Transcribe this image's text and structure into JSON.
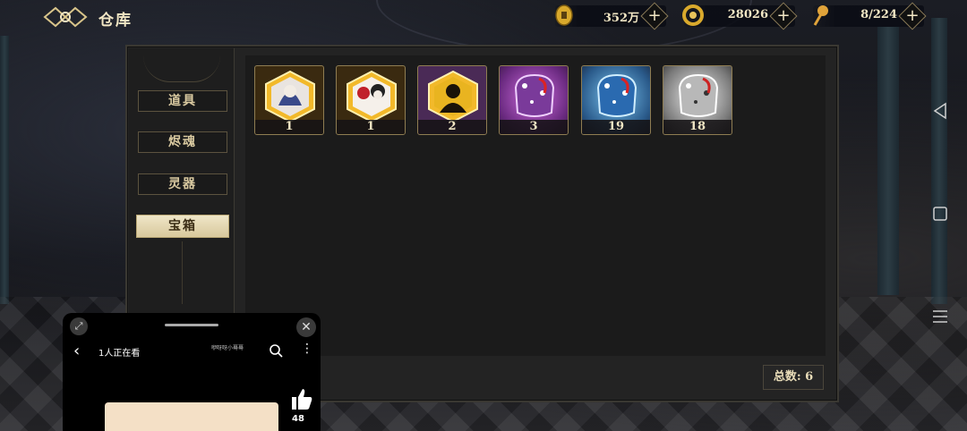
{
  "header": {
    "title": "仓库",
    "resources": [
      {
        "name": "coin",
        "value": "352万",
        "icon": "coin-icon"
      },
      {
        "name": "jade",
        "value": "28026",
        "icon": "jade-icon"
      },
      {
        "name": "tickets",
        "value": "8/224",
        "icon": "pin-icon"
      }
    ]
  },
  "sidebar": {
    "tabs": [
      "道具",
      "烬魂",
      "灵器",
      "宝箱"
    ],
    "active": "宝箱"
  },
  "items": [
    {
      "count": "1",
      "color": "#f2b92a"
    },
    {
      "count": "1",
      "color": "#f2b92a"
    },
    {
      "count": "2",
      "color": "#f2b92a"
    },
    {
      "count": "3",
      "color": "#b04ac8"
    },
    {
      "count": "19",
      "color": "#3a8cc9"
    },
    {
      "count": "18",
      "color": "#d9d9d9"
    }
  ],
  "footer": {
    "total": "总数: 6"
  },
  "video": {
    "watching": "1人正在看",
    "channel": "咿呀呀小蓦蓦",
    "likes": "48"
  }
}
